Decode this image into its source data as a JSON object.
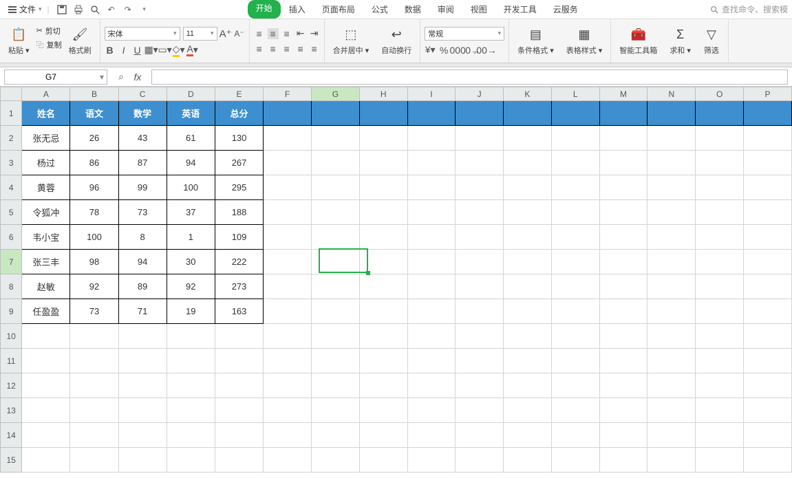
{
  "menubar": {
    "file_label": "文件",
    "tabs": [
      "开始",
      "插入",
      "页面布局",
      "公式",
      "数据",
      "审阅",
      "视图",
      "开发工具",
      "云服务"
    ],
    "active_tab": 0,
    "search_hint": "查找命令、搜索模"
  },
  "qat_icons": [
    "save-icon",
    "print-icon",
    "preview-icon",
    "undo-icon",
    "redo-icon"
  ],
  "ribbon": {
    "paste_label": "粘贴",
    "cut_label": "剪切",
    "copy_label": "复制",
    "format_painter_label": "格式刷",
    "font_name": "宋体",
    "font_size": "11",
    "merge_center_label": "合并居中",
    "wrap_text_label": "自动换行",
    "number_format": "常规",
    "cond_fmt_label": "条件格式",
    "table_style_label": "表格样式",
    "smart_toolbox_label": "智能工具箱",
    "sum_label": "求和",
    "filter_label": "筛选"
  },
  "namebox": {
    "value": "G7"
  },
  "formula_bar": {
    "value": ""
  },
  "columns": [
    "A",
    "B",
    "C",
    "D",
    "E",
    "F",
    "G",
    "H",
    "I",
    "J",
    "K",
    "L",
    "M",
    "N",
    "O",
    "P"
  ],
  "row_count": 15,
  "active_cell": {
    "col": "G",
    "row": 7
  },
  "table": {
    "headers": [
      "姓名",
      "语文",
      "数学",
      "英语",
      "总分"
    ],
    "rows": [
      [
        "张无忌",
        "26",
        "43",
        "61",
        "130"
      ],
      [
        "杨过",
        "86",
        "87",
        "94",
        "267"
      ],
      [
        "黄蓉",
        "96",
        "99",
        "100",
        "295"
      ],
      [
        "令狐冲",
        "78",
        "73",
        "37",
        "188"
      ],
      [
        "韦小宝",
        "100",
        "8",
        "1",
        "109"
      ],
      [
        "张三丰",
        "98",
        "94",
        "30",
        "222"
      ],
      [
        "赵敏",
        "92",
        "89",
        "92",
        "273"
      ],
      [
        "任盈盈",
        "73",
        "71",
        "19",
        "163"
      ]
    ]
  },
  "chart_data": {
    "type": "table",
    "title": "",
    "columns": [
      "姓名",
      "语文",
      "数学",
      "英语",
      "总分"
    ],
    "rows": [
      {
        "姓名": "张无忌",
        "语文": 26,
        "数学": 43,
        "英语": 61,
        "总分": 130
      },
      {
        "姓名": "杨过",
        "语文": 86,
        "数学": 87,
        "英语": 94,
        "总分": 267
      },
      {
        "姓名": "黄蓉",
        "语文": 96,
        "数学": 99,
        "英语": 100,
        "总分": 295
      },
      {
        "姓名": "令狐冲",
        "语文": 78,
        "数学": 73,
        "英语": 37,
        "总分": 188
      },
      {
        "姓名": "韦小宝",
        "语文": 100,
        "数学": 8,
        "英语": 1,
        "总分": 109
      },
      {
        "姓名": "张三丰",
        "语文": 98,
        "数学": 94,
        "英语": 30,
        "总分": 222
      },
      {
        "姓名": "赵敏",
        "语文": 92,
        "数学": 89,
        "英语": 92,
        "总分": 273
      },
      {
        "姓名": "任盈盈",
        "语文": 73,
        "数学": 71,
        "英语": 19,
        "总分": 163
      }
    ]
  }
}
